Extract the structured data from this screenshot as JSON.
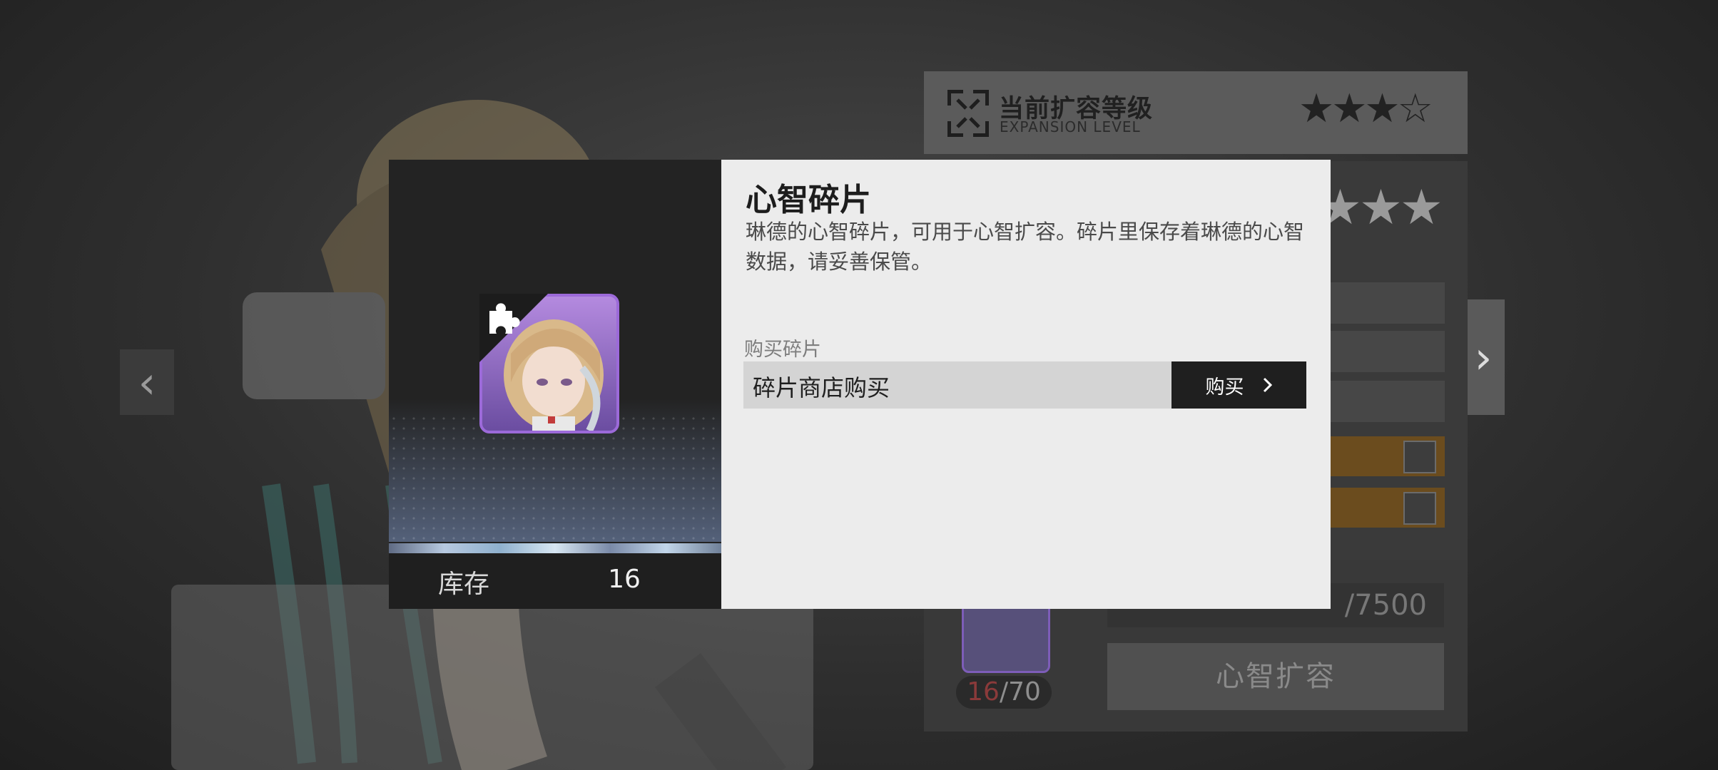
{
  "navigation": {
    "prev_icon": "chevron-left-icon",
    "next_icon": "chevron-right-icon"
  },
  "expansion": {
    "title": "当前扩容等级",
    "subtitle": "EXPANSION LEVEL",
    "stars": "★★★☆",
    "icon": "expand-frame-icon"
  },
  "background_panel": {
    "stars": "★★★",
    "fragment_count_current": "16",
    "fragment_count_total": "/70",
    "progress_total": "/7500",
    "action_label": "心智扩容",
    "magnify_icon": "search-icon"
  },
  "dialog": {
    "item_name": "心智碎片",
    "description": "琳德的心智碎片，可用于心智扩容。碎片里保存着琳德的心智数据，请妥善保管。",
    "stock_label": "库存",
    "stock_value": "16",
    "buy_section_label": "购买碎片",
    "buy_source": "碎片商店购买",
    "buy_button": "购买",
    "item_icon": "puzzle-piece-icon",
    "colors": {
      "item_frame": "#9c6ad9",
      "dialog_right_bg": "#ececec",
      "buy_button_bg": "#1f1f1f"
    }
  }
}
